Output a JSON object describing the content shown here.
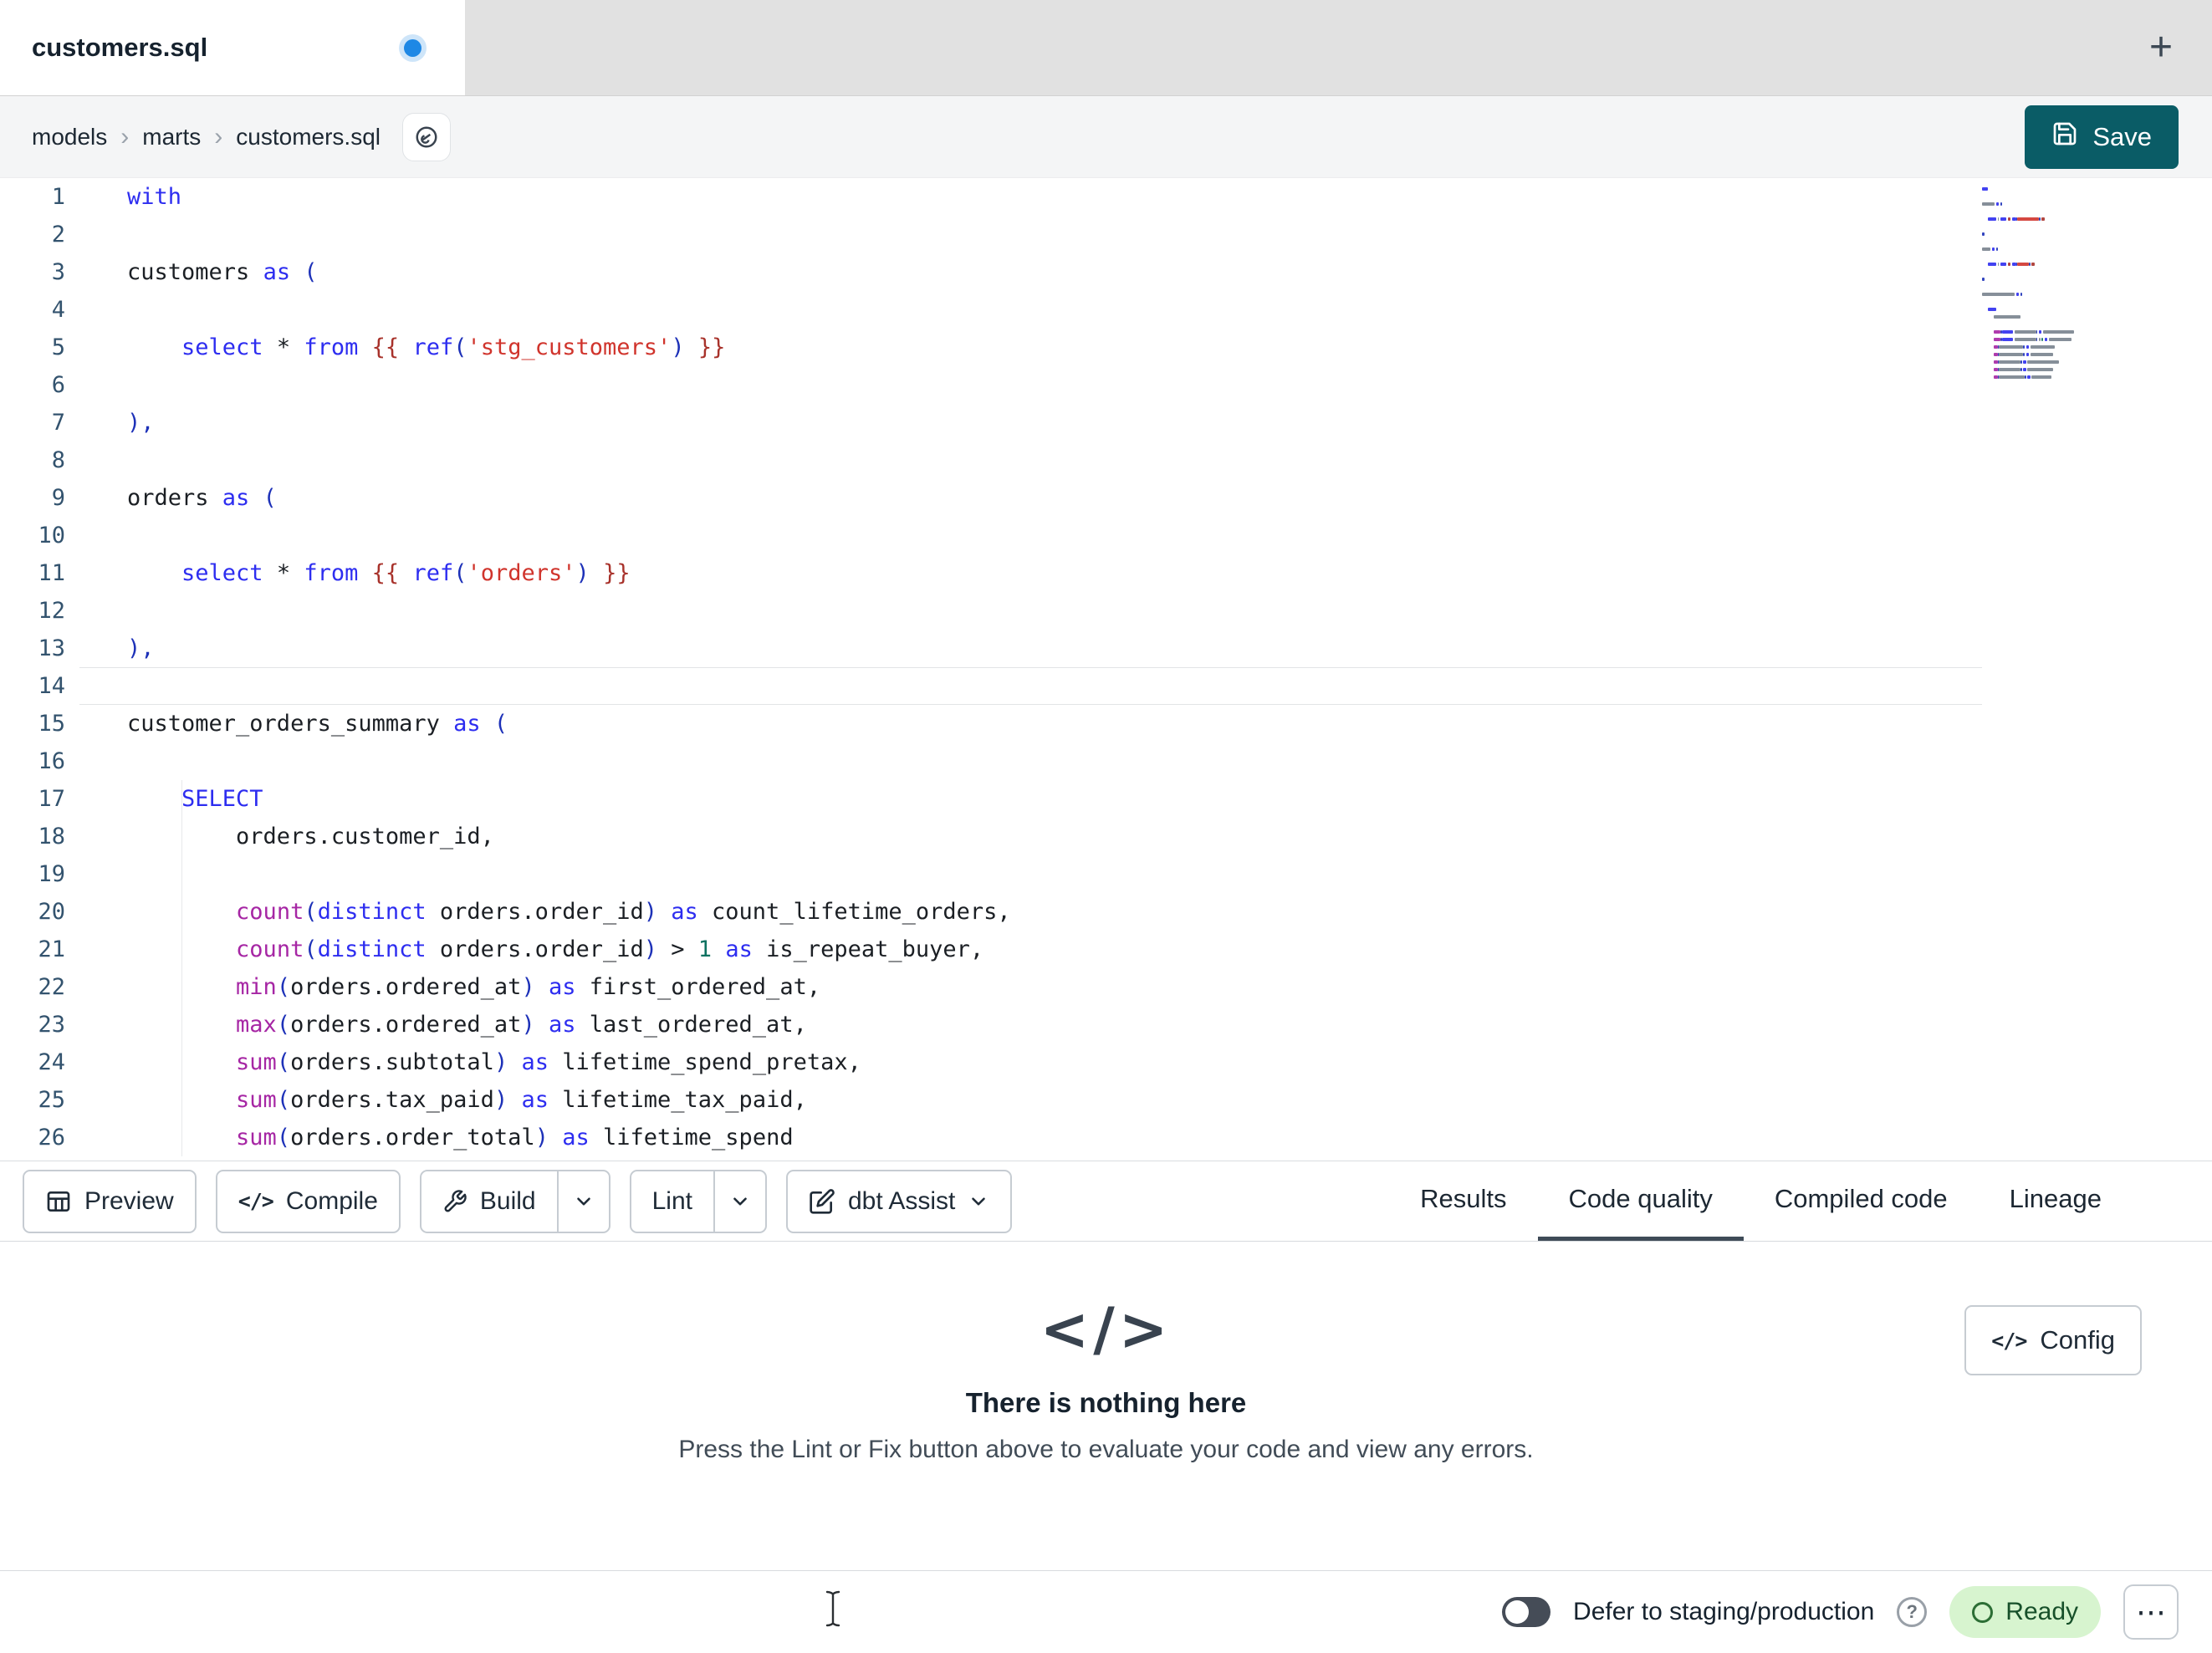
{
  "window": {
    "tab_title": "customers.sql",
    "has_unsaved_changes": true,
    "new_tab_icon": "+"
  },
  "breadcrumb": {
    "items": [
      "models",
      "marts",
      "customers.sql"
    ],
    "separator": "›"
  },
  "save_button": {
    "label": "Save"
  },
  "editor": {
    "active_line": 14,
    "total_lines": 26,
    "syntax_colors": {
      "keyword": "#2d2df0",
      "function": "#a626a4",
      "string": "#d0342c",
      "jinja": "#a8322b",
      "bracket": "#1d31b8",
      "number": "#0e7261",
      "plain": "#1b1f24",
      "line_number": "#33536e"
    },
    "lines": [
      [
        [
          "kw",
          "with"
        ]
      ],
      [],
      [
        [
          "plain",
          "customers "
        ],
        [
          "kw",
          "as"
        ],
        [
          "plain",
          " "
        ],
        [
          "brk",
          "("
        ]
      ],
      [],
      [
        [
          "plain",
          "    "
        ],
        [
          "kw",
          "select"
        ],
        [
          "plain",
          " * "
        ],
        [
          "kw",
          "from"
        ],
        [
          "plain",
          " "
        ],
        [
          "jinja",
          "{{"
        ],
        [
          "plain",
          " "
        ],
        [
          "kw",
          "ref"
        ],
        [
          "brk",
          "("
        ],
        [
          "str",
          "'stg_customers'"
        ],
        [
          "brk",
          ")"
        ],
        [
          "plain",
          " "
        ],
        [
          "jinja",
          "}}"
        ]
      ],
      [],
      [
        [
          "brk",
          "),"
        ]
      ],
      [],
      [
        [
          "plain",
          "orders "
        ],
        [
          "kw",
          "as"
        ],
        [
          "plain",
          " "
        ],
        [
          "brk",
          "("
        ]
      ],
      [],
      [
        [
          "plain",
          "    "
        ],
        [
          "kw",
          "select"
        ],
        [
          "plain",
          " * "
        ],
        [
          "kw",
          "from"
        ],
        [
          "plain",
          " "
        ],
        [
          "jinja",
          "{{"
        ],
        [
          "plain",
          " "
        ],
        [
          "kw",
          "ref"
        ],
        [
          "brk",
          "("
        ],
        [
          "str",
          "'orders'"
        ],
        [
          "brk",
          ")"
        ],
        [
          "plain",
          " "
        ],
        [
          "jinja",
          "}}"
        ]
      ],
      [],
      [
        [
          "brk",
          "),"
        ]
      ],
      [],
      [
        [
          "plain",
          "customer_orders_summary "
        ],
        [
          "kw",
          "as"
        ],
        [
          "plain",
          " "
        ],
        [
          "brk",
          "("
        ]
      ],
      [],
      [
        [
          "plain",
          "    "
        ],
        [
          "kw",
          "SELECT"
        ]
      ],
      [
        [
          "plain",
          "        orders.customer_id,"
        ]
      ],
      [],
      [
        [
          "plain",
          "        "
        ],
        [
          "fn",
          "count"
        ],
        [
          "brk",
          "("
        ],
        [
          "kw",
          "distinct"
        ],
        [
          "plain",
          " orders.order_id"
        ],
        [
          "brk",
          ")"
        ],
        [
          "plain",
          " "
        ],
        [
          "kw",
          "as"
        ],
        [
          "plain",
          " count_lifetime_orders,"
        ]
      ],
      [
        [
          "plain",
          "        "
        ],
        [
          "fn",
          "count"
        ],
        [
          "brk",
          "("
        ],
        [
          "kw",
          "distinct"
        ],
        [
          "plain",
          " orders.order_id"
        ],
        [
          "brk",
          ")"
        ],
        [
          "plain",
          " > "
        ],
        [
          "num",
          "1"
        ],
        [
          "plain",
          " "
        ],
        [
          "kw",
          "as"
        ],
        [
          "plain",
          " is_repeat_buyer,"
        ]
      ],
      [
        [
          "plain",
          "        "
        ],
        [
          "fn",
          "min"
        ],
        [
          "brk",
          "("
        ],
        [
          "plain",
          "orders.ordered_at"
        ],
        [
          "brk",
          ")"
        ],
        [
          "plain",
          " "
        ],
        [
          "kw",
          "as"
        ],
        [
          "plain",
          " first_ordered_at,"
        ]
      ],
      [
        [
          "plain",
          "        "
        ],
        [
          "fn",
          "max"
        ],
        [
          "brk",
          "("
        ],
        [
          "plain",
          "orders.ordered_at"
        ],
        [
          "brk",
          ")"
        ],
        [
          "plain",
          " "
        ],
        [
          "kw",
          "as"
        ],
        [
          "plain",
          " last_ordered_at,"
        ]
      ],
      [
        [
          "plain",
          "        "
        ],
        [
          "fn",
          "sum"
        ],
        [
          "brk",
          "("
        ],
        [
          "plain",
          "orders.subtotal"
        ],
        [
          "brk",
          ")"
        ],
        [
          "plain",
          " "
        ],
        [
          "kw",
          "as"
        ],
        [
          "plain",
          " lifetime_spend_pretax,"
        ]
      ],
      [
        [
          "plain",
          "        "
        ],
        [
          "fn",
          "sum"
        ],
        [
          "brk",
          "("
        ],
        [
          "plain",
          "orders.tax_paid"
        ],
        [
          "brk",
          ")"
        ],
        [
          "plain",
          " "
        ],
        [
          "kw",
          "as"
        ],
        [
          "plain",
          " lifetime_tax_paid,"
        ]
      ],
      [
        [
          "plain",
          "        "
        ],
        [
          "fn",
          "sum"
        ],
        [
          "brk",
          "("
        ],
        [
          "plain",
          "orders.order_total"
        ],
        [
          "brk",
          ")"
        ],
        [
          "plain",
          " "
        ],
        [
          "kw",
          "as"
        ],
        [
          "plain",
          " lifetime_spend"
        ]
      ]
    ]
  },
  "toolbar": {
    "preview_label": "Preview",
    "compile_label": "Compile",
    "compile_icon": "</>",
    "build_label": "Build",
    "lint_label": "Lint",
    "assist_label": "dbt Assist",
    "tabs": [
      {
        "label": "Results",
        "active": false
      },
      {
        "label": "Code quality",
        "active": true
      },
      {
        "label": "Compiled code",
        "active": false
      },
      {
        "label": "Lineage",
        "active": false
      }
    ]
  },
  "results_panel": {
    "empty_icon": "</>",
    "title": "There is nothing here",
    "message": "Press the Lint or Fix button above to evaluate your code and view any errors.",
    "config_button": {
      "label": "Config",
      "icon": "</>"
    }
  },
  "statusbar": {
    "defer_toggle": {
      "label": "Defer to staging/production",
      "enabled": false
    },
    "help_icon": "?",
    "status_badge": {
      "label": "Ready"
    },
    "overflow_icon": "⋯"
  },
  "colors": {
    "save_button": "#0a5c66",
    "ready_badge_bg": "#d7f4cf",
    "ready_badge_text": "#17502a",
    "active_tab_underline": "#3f4b57",
    "unsaved_dot": "#1e88e5"
  }
}
